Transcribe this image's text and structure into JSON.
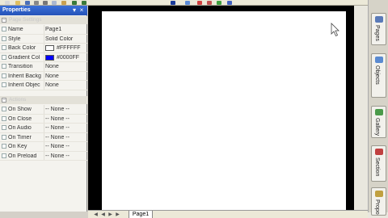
{
  "toolbar": {
    "icons": [
      {
        "name": "new-icon",
        "color": "#d8d8d8"
      },
      {
        "name": "open-icon",
        "color": "#e0c060"
      },
      {
        "name": "save-icon",
        "color": "#4a6fb8"
      },
      {
        "name": "print-icon",
        "color": "#888888"
      },
      {
        "name": "cut-icon",
        "color": "#777777"
      },
      {
        "name": "copy-icon",
        "color": "#aab8d0"
      },
      {
        "name": "paste-icon",
        "color": "#c8a050"
      },
      {
        "name": "undo-icon",
        "color": "#3a7a3a"
      },
      {
        "name": "redo-icon",
        "color": "#3a7a3a"
      },
      {
        "name": "text-icon",
        "color": "#1a3a9a"
      },
      {
        "name": "image-icon",
        "color": "#5a8ad8"
      },
      {
        "name": "shape-icon",
        "color": "#d04040"
      },
      {
        "name": "button-icon",
        "color": "#c05050"
      },
      {
        "name": "play-icon",
        "color": "#40a040"
      },
      {
        "name": "preview-icon",
        "color": "#4060c0"
      },
      {
        "name": "help-icon",
        "color": "#4070d0"
      }
    ]
  },
  "properties": {
    "title": "Properties",
    "sections": {
      "page_settings": "Page Settings",
      "actions": "Actions"
    },
    "rows": [
      {
        "name": "Name",
        "value": "Page1"
      },
      {
        "name": "Style",
        "value": "Solid Color"
      },
      {
        "name": "Back Color",
        "value": "#FFFFFF",
        "swatch": "#ffffff"
      },
      {
        "name": "Gradient Col",
        "value": "#0000FF",
        "swatch": "#0000ff"
      },
      {
        "name": "Transition",
        "value": "None"
      },
      {
        "name": "Inherit Backg",
        "value": "None"
      },
      {
        "name": "Inherit Objec",
        "value": "None"
      }
    ],
    "actions": [
      {
        "name": "On Show",
        "value": "-- None --"
      },
      {
        "name": "On Close",
        "value": "-- None --"
      },
      {
        "name": "On Audio",
        "value": "-- None --"
      },
      {
        "name": "On Timer",
        "value": "-- None --"
      },
      {
        "name": "On Key",
        "value": "-- None --"
      },
      {
        "name": "On Preload",
        "value": "-- None --"
      }
    ]
  },
  "dock_tabs": [
    {
      "label": "Pages",
      "icon": "pages-icon",
      "color": "#5a7ab8"
    },
    {
      "label": "Objects",
      "icon": "objects-icon",
      "color": "#5a8ad0"
    },
    {
      "label": "Gallery",
      "icon": "gallery-icon",
      "color": "#4a9a4a"
    },
    {
      "label": "Section",
      "icon": "section-icon",
      "color": "#c04040"
    },
    {
      "label": "Propo",
      "icon": "propo-icon",
      "color": "#c0a040"
    }
  ],
  "bottom": {
    "page_tab": "Page1"
  },
  "colors": {
    "titlebar": "#2553b8",
    "canvas": "#ffffff",
    "workspace": "#000000"
  }
}
